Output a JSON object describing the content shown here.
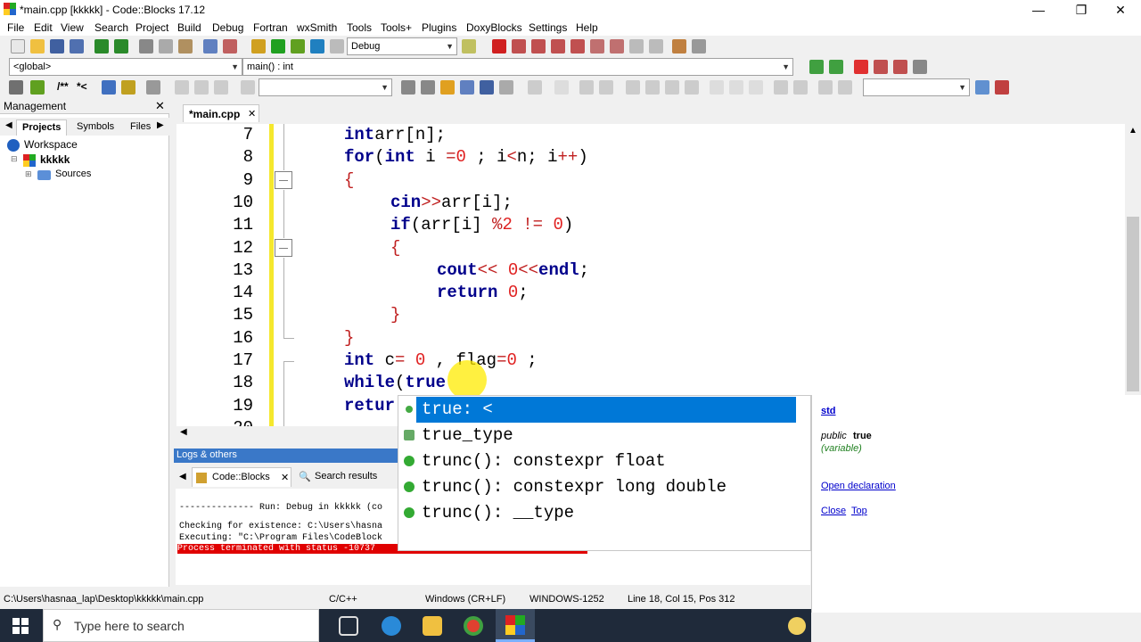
{
  "window": {
    "title": "*main.cpp [kkkkk] - Code::Blocks 17.12",
    "minimize": "—",
    "maximize": "❐",
    "close": "✕"
  },
  "menu": [
    "File",
    "Edit",
    "View",
    "Search",
    "Project",
    "Build",
    "Debug",
    "Fortran",
    "wxSmith",
    "Tools",
    "Tools+",
    "Plugins",
    "DoxyBlocks",
    "Settings",
    "Help"
  ],
  "toolbar": {
    "build_target": "Debug",
    "scope": "<global>",
    "function": "main() : int",
    "comment1": "/**",
    "comment2": "*<"
  },
  "management": {
    "title": "Management",
    "tabs": [
      "Projects",
      "Symbols",
      "Files"
    ],
    "tree": {
      "workspace": "Workspace",
      "project": "kkkkk",
      "folder": "Sources"
    }
  },
  "editor": {
    "tab": "*main.cpp",
    "lines": [
      {
        "n": "7",
        "code": [
          [
            "kw",
            "int"
          ],
          [
            "",
            "arr["
          ],
          [
            "",
            "n"
          ],
          [
            "",
            "];"
          ]
        ]
      },
      {
        "n": "8",
        "code": [
          [
            "kw",
            "for"
          ],
          [
            "",
            "("
          ],
          [
            "kw",
            "int"
          ],
          [
            "",
            " i "
          ],
          [
            "op",
            "="
          ],
          [
            "num",
            "0"
          ],
          [
            "",
            " ; i"
          ],
          [
            "op",
            "<"
          ],
          [
            "",
            "n; i"
          ],
          [
            "op",
            "++"
          ],
          [
            "",
            ")"
          ]
        ]
      },
      {
        "n": "9",
        "code": [
          [
            "op",
            "{"
          ]
        ]
      },
      {
        "n": "10",
        "code": [
          [
            "kw",
            "cin"
          ],
          [
            "op",
            ">>"
          ],
          [
            "",
            "arr[i];"
          ]
        ]
      },
      {
        "n": "11",
        "code": [
          [
            "kw",
            "if"
          ],
          [
            "",
            "(arr[i] "
          ],
          [
            "op",
            "%"
          ],
          [
            "num",
            "2"
          ],
          [
            "",
            " "
          ],
          [
            "op",
            "!="
          ],
          [
            "",
            " "
          ],
          [
            "num",
            "0"
          ],
          [
            "",
            ")"
          ]
        ]
      },
      {
        "n": "12",
        "code": [
          [
            "op",
            "{"
          ]
        ]
      },
      {
        "n": "13",
        "code": [
          [
            "kw",
            "cout"
          ],
          [
            "op",
            "<<"
          ],
          [
            "",
            " "
          ],
          [
            "num",
            "0"
          ],
          [
            "op",
            "<<"
          ],
          [
            "kw",
            "endl"
          ],
          [
            "",
            ";"
          ]
        ]
      },
      {
        "n": "14",
        "code": [
          [
            "kw",
            "return"
          ],
          [
            "",
            " "
          ],
          [
            "num",
            "0"
          ],
          [
            "",
            ";"
          ]
        ]
      },
      {
        "n": "15",
        "code": [
          [
            "op",
            "}"
          ]
        ]
      },
      {
        "n": "16",
        "code": [
          [
            "op",
            "}"
          ]
        ]
      },
      {
        "n": "17",
        "code": [
          [
            "kw",
            "int"
          ],
          [
            "",
            " c"
          ],
          [
            "op",
            "="
          ],
          [
            "",
            " "
          ],
          [
            "num",
            "0"
          ],
          [
            "",
            " , flag"
          ],
          [
            "op",
            "="
          ],
          [
            "num",
            "0"
          ],
          [
            "",
            " ;"
          ]
        ]
      },
      {
        "n": "18",
        "code": [
          [
            "kw",
            "while"
          ],
          [
            "",
            "("
          ],
          [
            "kw",
            "true"
          ]
        ]
      },
      {
        "n": "19",
        "code": [
          [
            "kw",
            "retur"
          ]
        ]
      },
      {
        "n": "20",
        "code": []
      }
    ]
  },
  "autocomplete": {
    "items": [
      "true: <",
      "true_type",
      "trunc(): constexpr float",
      "trunc(): constexpr long double",
      "trunc(): __type"
    ],
    "doc": {
      "namespace": "std",
      "scope": "public",
      "name": "true",
      "kind": "(variable)",
      "open": "Open declaration",
      "close": "Close",
      "top": "Top"
    }
  },
  "logs": {
    "title": "Logs & others",
    "tabs": [
      "Code::Blocks",
      "Search results"
    ],
    "lines": [
      "-------------- Run: Debug in kkkkk (co",
      "Checking for existence: C:\\Users\\hasna",
      "Executing: \"C:\\Program Files\\CodeBlock",
      "Process terminated with status -10737"
    ]
  },
  "status": {
    "path": "C:\\Users\\hasnaa_lap\\Desktop\\kkkkk\\main.cpp",
    "lang": "C/C++",
    "eol": "Windows (CR+LF)",
    "enc": "WINDOWS-1252",
    "pos": "Line 18, Col 15, Pos 312"
  },
  "taskbar": {
    "search": "Type here to search"
  },
  "colors": {
    "accent": "#3a78c8",
    "selection": "#0078d7",
    "keyword": "#00008b",
    "number": "#e02020",
    "error": "#ff0000"
  }
}
